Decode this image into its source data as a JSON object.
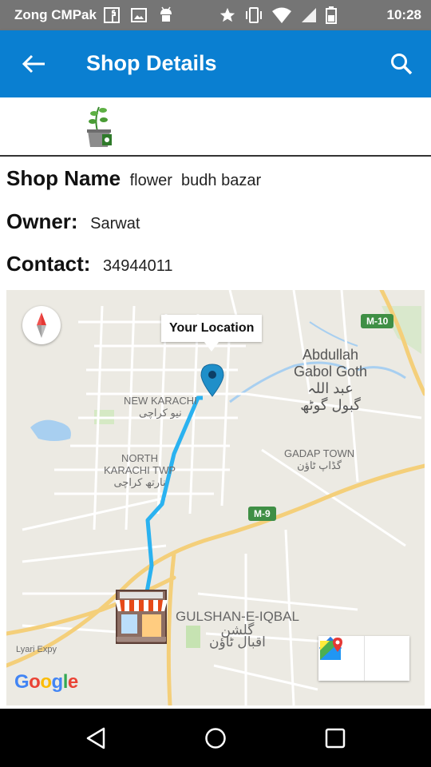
{
  "status_bar": {
    "carrier": "Zong CMPak",
    "time": "10:28",
    "icons": [
      "facebook-icon",
      "image-icon",
      "android-icon",
      "star-icon",
      "vibrate-icon",
      "wifi-icon",
      "signal-icon",
      "battery-icon"
    ]
  },
  "app_bar": {
    "title": "Shop Details",
    "back_icon": "arrow-back-icon",
    "search_icon": "search-icon"
  },
  "shop": {
    "name_label": "Shop Name",
    "name_value": "flower  budh bazar",
    "owner_label": "Owner:",
    "owner_value": "Sarwat",
    "contact_label": "Contact:",
    "contact_value": "34944011"
  },
  "map": {
    "callout": "Your Location",
    "labels": {
      "abdullah_line1": "Abdullah",
      "abdullah_line2": "Gabol Goth",
      "abdullah_urdu1": "عبد اللہ",
      "abdullah_urdu2": "گبول گوٹھ",
      "new_karachi": "NEW KARACHI",
      "new_karachi_urdu": "نیو کراچی",
      "north_karachi_line1": "NORTH",
      "north_karachi_line2": "KARACHI TWP",
      "north_karachi_urdu": "نارتھ کراچی",
      "gadap": "GADAP TOWN",
      "gadap_urdu": "گڈاپ ٹاؤن",
      "gulshan": "GULSHAN-E-IQBAL",
      "gulshan_urdu1": "گلشن",
      "gulshan_urdu2": "اقبال ٹاؤن",
      "lyari": "Lyari Expy",
      "m10": "M-10",
      "m9": "M-9",
      "google": "Google"
    },
    "colors": {
      "route": "#2ab2f0",
      "marker": "#1f8fc9",
      "highway": "#f4cf7a",
      "green_shield": "#3f8f45"
    }
  },
  "nav_bar": {
    "back": "nav-back-icon",
    "home": "nav-home-icon",
    "recents": "nav-recents-icon"
  }
}
